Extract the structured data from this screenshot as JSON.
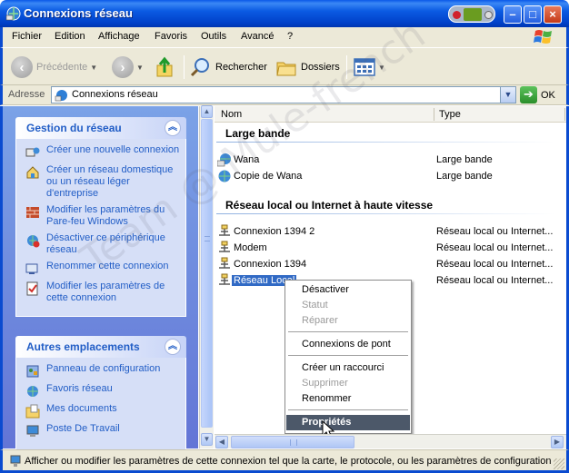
{
  "window": {
    "title": "Connexions réseau"
  },
  "menu": [
    "Fichier",
    "Edition",
    "Affichage",
    "Favoris",
    "Outils",
    "Avancé",
    "?"
  ],
  "toolbar": {
    "back": "Précédente",
    "search": "Rechercher",
    "folders": "Dossiers"
  },
  "address": {
    "label": "Adresse",
    "value": "Connexions réseau",
    "go": "OK"
  },
  "left": {
    "network_tasks": {
      "title": "Gestion du réseau",
      "items": [
        "Créer une nouvelle connexion",
        "Créer un réseau domestique ou un réseau léger d'entreprise",
        "Modifier les paramètres du Pare-feu Windows",
        "Désactiver ce périphérique réseau",
        "Renommer cette connexion",
        "Modifier les paramètres de cette connexion"
      ]
    },
    "other_places": {
      "title": "Autres emplacements",
      "items": [
        "Panneau de configuration",
        "Favoris réseau",
        "Mes documents",
        "Poste De Travail"
      ]
    }
  },
  "list": {
    "columns": {
      "name": "Nom",
      "type": "Type"
    },
    "groups": [
      {
        "title": "Large bande",
        "rows": [
          {
            "name": "Wana",
            "type": "Large bande"
          },
          {
            "name": "Copie de Wana",
            "type": "Large bande"
          }
        ]
      },
      {
        "title": "Réseau local ou Internet à haute vitesse",
        "rows": [
          {
            "name": "Connexion 1394 2",
            "type": "Réseau local ou Internet..."
          },
          {
            "name": "Modem",
            "type": "Réseau local ou Internet..."
          },
          {
            "name": "Connexion 1394",
            "type": "Réseau local ou Internet..."
          },
          {
            "name": "Réseau Local",
            "type": "Réseau local ou Internet..."
          }
        ]
      }
    ]
  },
  "context_menu": {
    "disable": "Désactiver",
    "status": "Statut",
    "repair": "Réparer",
    "bridge": "Connexions de pont",
    "shortcut": "Créer un raccourci",
    "delete": "Supprimer",
    "rename": "Renommer",
    "properties": "Propriétés"
  },
  "status": "Afficher ou modifier les paramètres de cette connexion tel que la carte, le protocole, ou les paramètres de configuration",
  "watermark": "Team @ Mule-french",
  "colors": {
    "title_bar": "#0040c8",
    "task_link": "#215dc6",
    "selection": "#316ac5",
    "menu_highlight": "#4c5869"
  }
}
